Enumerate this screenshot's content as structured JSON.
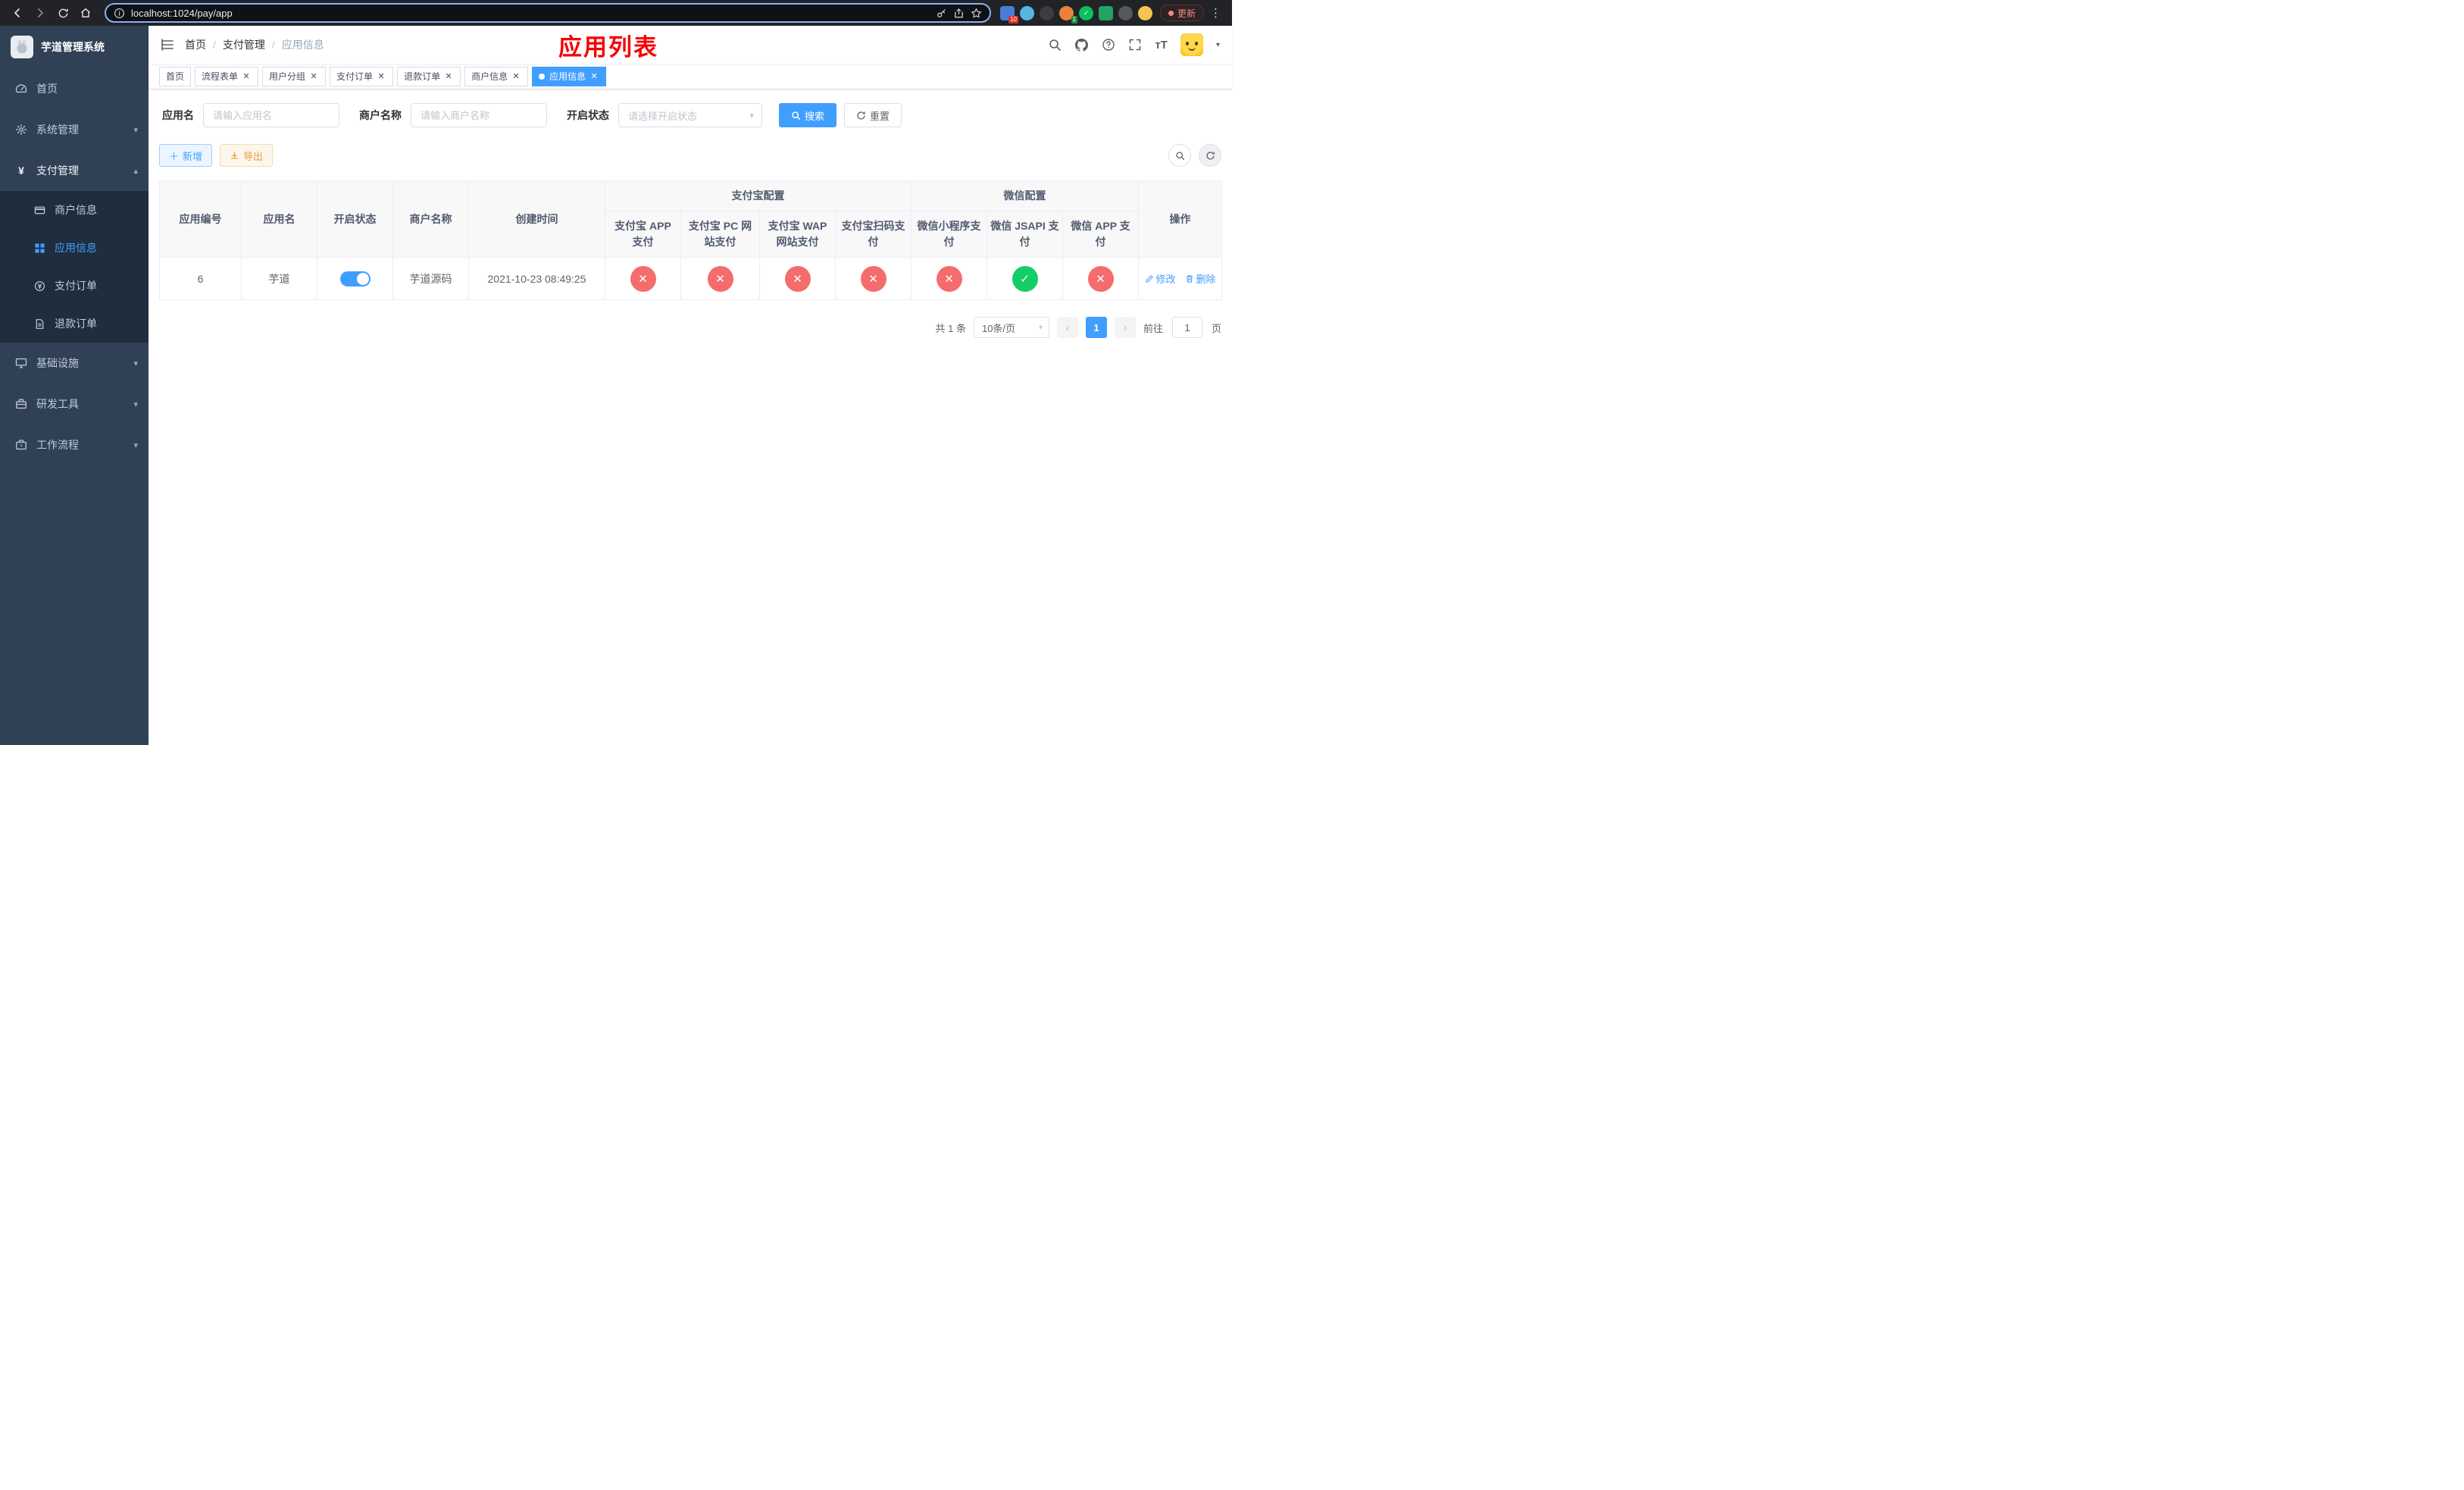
{
  "browser": {
    "url": "localhost:1024/pay/app",
    "update_label": "更新",
    "ext_badge_puzzle": "10",
    "ext_badge_green": "1"
  },
  "sidebar": {
    "logo_title": "芋道管理系统",
    "items": [
      {
        "label": "首页",
        "icon": "dashboard-icon"
      },
      {
        "label": "系统管理",
        "icon": "gear-icon"
      },
      {
        "label": "支付管理",
        "icon": "yen-icon"
      },
      {
        "label": "基础设施",
        "icon": "monitor-icon"
      },
      {
        "label": "研发工具",
        "icon": "toolbox-icon"
      },
      {
        "label": "工作流程",
        "icon": "suitcase-icon"
      }
    ],
    "submenu": [
      {
        "label": "商户信息",
        "icon": "credit-card-icon"
      },
      {
        "label": "应用信息",
        "icon": "grid-icon",
        "active": true
      },
      {
        "label": "支付订单",
        "icon": "coin-icon"
      },
      {
        "label": "退款订单",
        "icon": "document-icon"
      }
    ]
  },
  "navbar": {
    "breadcrumb": [
      "首页",
      "支付管理",
      "应用信息"
    ],
    "page_title": "应用列表"
  },
  "tags": [
    {
      "label": "首页",
      "closable": false,
      "active": false
    },
    {
      "label": "流程表单",
      "closable": true,
      "active": false
    },
    {
      "label": "用户分组",
      "closable": true,
      "active": false
    },
    {
      "label": "支付订单",
      "closable": true,
      "active": false
    },
    {
      "label": "退款订单",
      "closable": true,
      "active": false
    },
    {
      "label": "商户信息",
      "closable": true,
      "active": false
    },
    {
      "label": "应用信息",
      "closable": true,
      "active": true
    }
  ],
  "filters": {
    "app_name_label": "应用名",
    "app_name_placeholder": "请输入应用名",
    "merchant_label": "商户名称",
    "merchant_placeholder": "请输入商户名称",
    "status_label": "开启状态",
    "status_placeholder": "请选择开启状态",
    "search_button": "搜索",
    "reset_button": "重置"
  },
  "toolbar": {
    "add_button": "新增",
    "export_button": "导出"
  },
  "table": {
    "headers": {
      "app_id": "应用编号",
      "app_name": "应用名",
      "status": "开启状态",
      "merchant": "商户名称",
      "create_time": "创建时间",
      "alipay_group": "支付宝配置",
      "wechat_group": "微信配置",
      "actions": "操作",
      "alipay_app": "支付宝 APP 支付",
      "alipay_pc": "支付宝 PC 网站支付",
      "alipay_wap": "支付宝 WAP 网站支付",
      "alipay_qr": "支付宝扫码支付",
      "wx_mini": "微信小程序支付",
      "wx_jsapi": "微信 JSAPI 支付",
      "wx_app": "微信 APP 支付"
    },
    "row": {
      "app_id": "6",
      "app_name": "芋道",
      "status_on": true,
      "merchant": "芋道源码",
      "create_time": "2021-10-23 08:49:25",
      "statuses": [
        false,
        false,
        false,
        false,
        false,
        true,
        false
      ],
      "edit_label": "修改",
      "delete_label": "删除"
    }
  },
  "pagination": {
    "total_text": "共 1 条",
    "page_size": "10条/页",
    "current_page": "1",
    "goto_label": "前往",
    "goto_value": "1",
    "page_label": "页"
  },
  "colors": {
    "primary": "#409eff",
    "success": "#13ce66",
    "danger": "#f56c6c",
    "title_red": "#f70000",
    "sidebar_bg": "#304156",
    "submenu_bg": "#1f2d3d"
  }
}
